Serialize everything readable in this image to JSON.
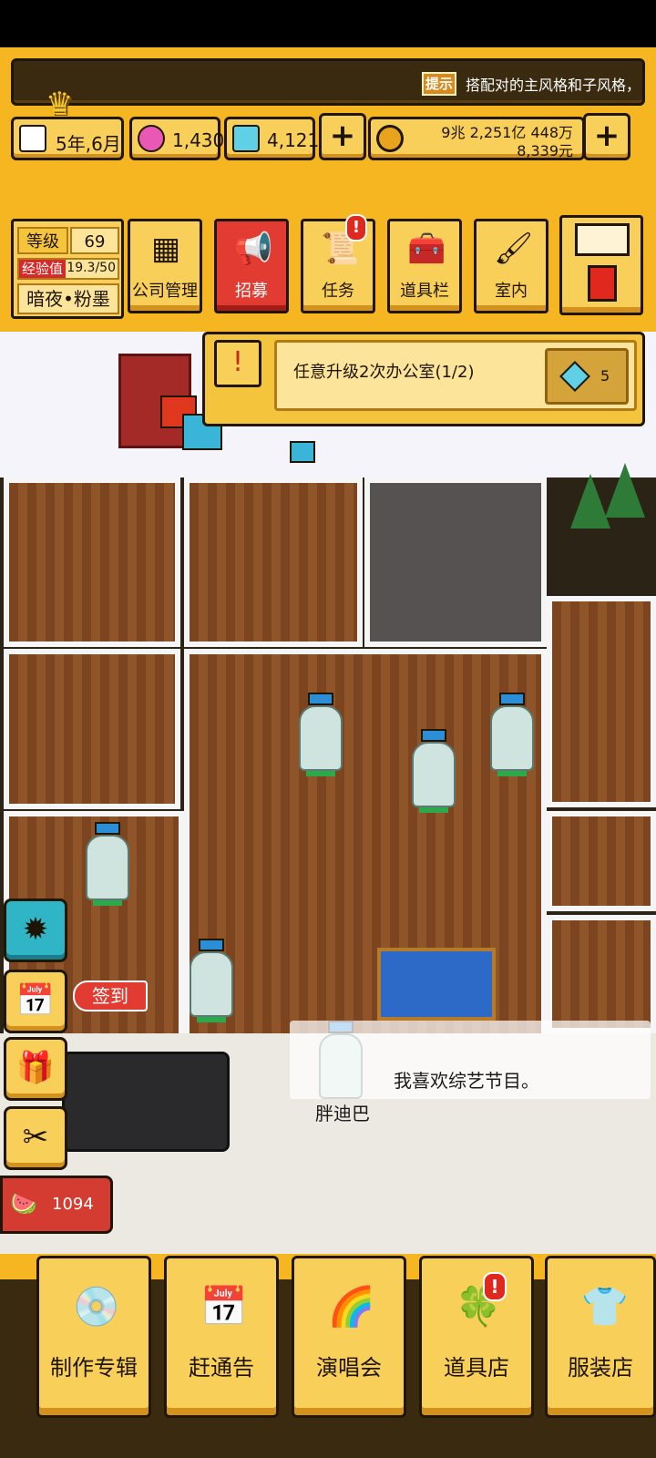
{
  "hint": {
    "badge": "提示",
    "text": "搭配对的主风格和子风格，"
  },
  "resources": {
    "date": "5年,6月",
    "pink_gem": "1,430",
    "blue_gem": "4,121",
    "money_line1": "9兆 2,251亿 448万",
    "money_line2": "8,339元"
  },
  "level": {
    "label": "等级",
    "value": "69",
    "exp_label": "经验值",
    "exp_value": "19.3/50",
    "exp_fraction": 0.386,
    "player_name": "暗夜•粉墨"
  },
  "menu": [
    {
      "label": "公司管理",
      "icon": "building-icon"
    },
    {
      "label": "招募",
      "icon": "megaphone-icon"
    },
    {
      "label": "任务",
      "icon": "scroll-icon",
      "alert": "!"
    },
    {
      "label": "道具栏",
      "icon": "chest-icon"
    },
    {
      "label": "室内",
      "icon": "paint-roller-icon"
    }
  ],
  "quest": {
    "icon_text": "!",
    "text": "任意升级2次办公室(1/2)",
    "reward": "5"
  },
  "side": {
    "checkin_label": "签到",
    "watermelon_count": "1094"
  },
  "dialogue": {
    "text": "我喜欢综艺节目。",
    "speaker": "胖迪巴"
  },
  "dock": [
    {
      "label": "制作专辑",
      "icon": "disc-icon"
    },
    {
      "label": "赶通告",
      "icon": "calendar-icon"
    },
    {
      "label": "演唱会",
      "icon": "rainbow-icon"
    },
    {
      "label": "道具店",
      "icon": "clover-icon",
      "alert": "!"
    },
    {
      "label": "服装店",
      "icon": "shirt-icon"
    }
  ],
  "colors": {
    "panel": "#f6b621",
    "button": "#f8cf58",
    "accent_red": "#e23c32",
    "outline": "#1f1606"
  }
}
